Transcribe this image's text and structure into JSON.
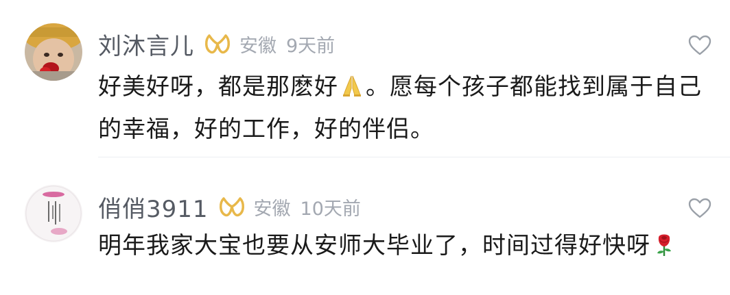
{
  "comments": [
    {
      "username": "刘沐言儿",
      "location": "安徽",
      "time": "9天前",
      "text_part1": "好美好呀，都是那麽好",
      "emoji1": "praying-hands",
      "text_part2": "。愿每个孩子都能找到属于自己的幸福，好的工作，好的伴侣。"
    },
    {
      "username": "俏俏3911",
      "location": "安徽",
      "time": "10天前",
      "text_part1": "明年我家大宝也要从安师大毕业了，时间过得好快呀",
      "emoji1": "rose"
    }
  ],
  "colors": {
    "username": "#555a63",
    "meta": "#a3a8b1",
    "text": "#1a1a1a",
    "badge": "#e8b84a",
    "divider": "#eceef1"
  }
}
